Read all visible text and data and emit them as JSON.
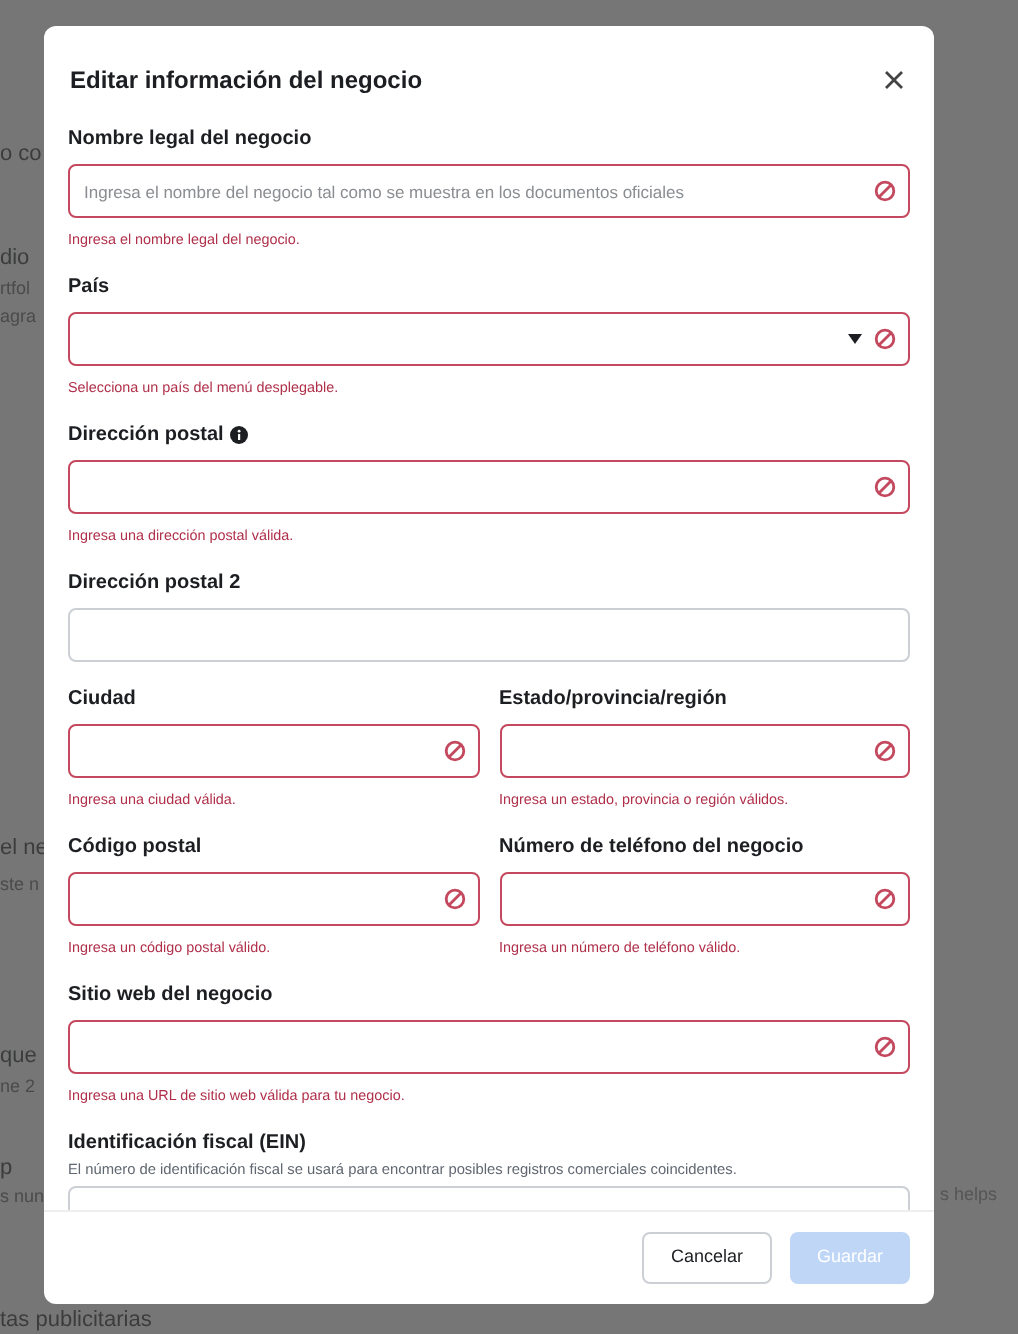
{
  "background": {
    "fragments": [
      {
        "text": "o co",
        "bold": true
      },
      {
        "text": "dio",
        "bold": true
      },
      {
        "text": "rtfol",
        "bold": false
      },
      {
        "text": "agra",
        "bold": false
      },
      {
        "text": "el ne",
        "bold": true
      },
      {
        "text": "ste n",
        "bold": false
      },
      {
        "text": "que",
        "bold": true
      },
      {
        "text": "ne 2",
        "bold": false
      },
      {
        "text": "p",
        "bold": true
      },
      {
        "text": "s nun",
        "bold": false
      },
      {
        "text": "tas publicitarias",
        "bold": true
      }
    ],
    "right_fragment": "s helps"
  },
  "modal": {
    "title": "Editar información del negocio",
    "rows": [
      [
        {
          "label": "Nombre legal del negocio",
          "kind": "text",
          "placeholder": "Ingresa el nombre del negocio tal como se muestra en los documentos oficiales",
          "invalid": true,
          "info": false,
          "error": "Ingresa el nombre legal del negocio."
        }
      ],
      [
        {
          "label": "País",
          "kind": "select",
          "invalid": true,
          "info": false,
          "error": "Selecciona un país del menú desplegable."
        }
      ],
      [
        {
          "label": "Dirección postal",
          "kind": "text",
          "invalid": true,
          "info": true,
          "error": "Ingresa una dirección postal válida."
        }
      ],
      [
        {
          "label": "Dirección postal 2",
          "kind": "text",
          "invalid": false,
          "info": false
        }
      ],
      [
        {
          "label": "Ciudad",
          "kind": "text",
          "invalid": true,
          "info": false,
          "error": "Ingresa una ciudad válida."
        },
        {
          "label": "Estado/provincia/región",
          "kind": "text",
          "invalid": true,
          "info": false,
          "error": "Ingresa un estado, provincia o región válidos."
        }
      ],
      [
        {
          "label": "Código postal",
          "kind": "text",
          "invalid": true,
          "info": false,
          "error": "Ingresa un código postal válido."
        },
        {
          "label": "Número de teléfono del negocio",
          "kind": "text",
          "invalid": true,
          "info": false,
          "error": "Ingresa un número de teléfono válido."
        }
      ],
      [
        {
          "label": "Sitio web del negocio",
          "kind": "text",
          "invalid": true,
          "info": false,
          "error": "Ingresa una URL de sitio web válida para tu negocio."
        }
      ],
      [
        {
          "label": "Identificación fiscal (EIN)",
          "kind": "text",
          "invalid": false,
          "info": false,
          "description": "El número de identificación fiscal se usará para encontrar posibles registros comerciales coincidentes."
        }
      ]
    ],
    "buttons": [
      {
        "label": "Cancelar",
        "disabled": false
      },
      {
        "label": "Guardar",
        "disabled": true
      }
    ]
  }
}
